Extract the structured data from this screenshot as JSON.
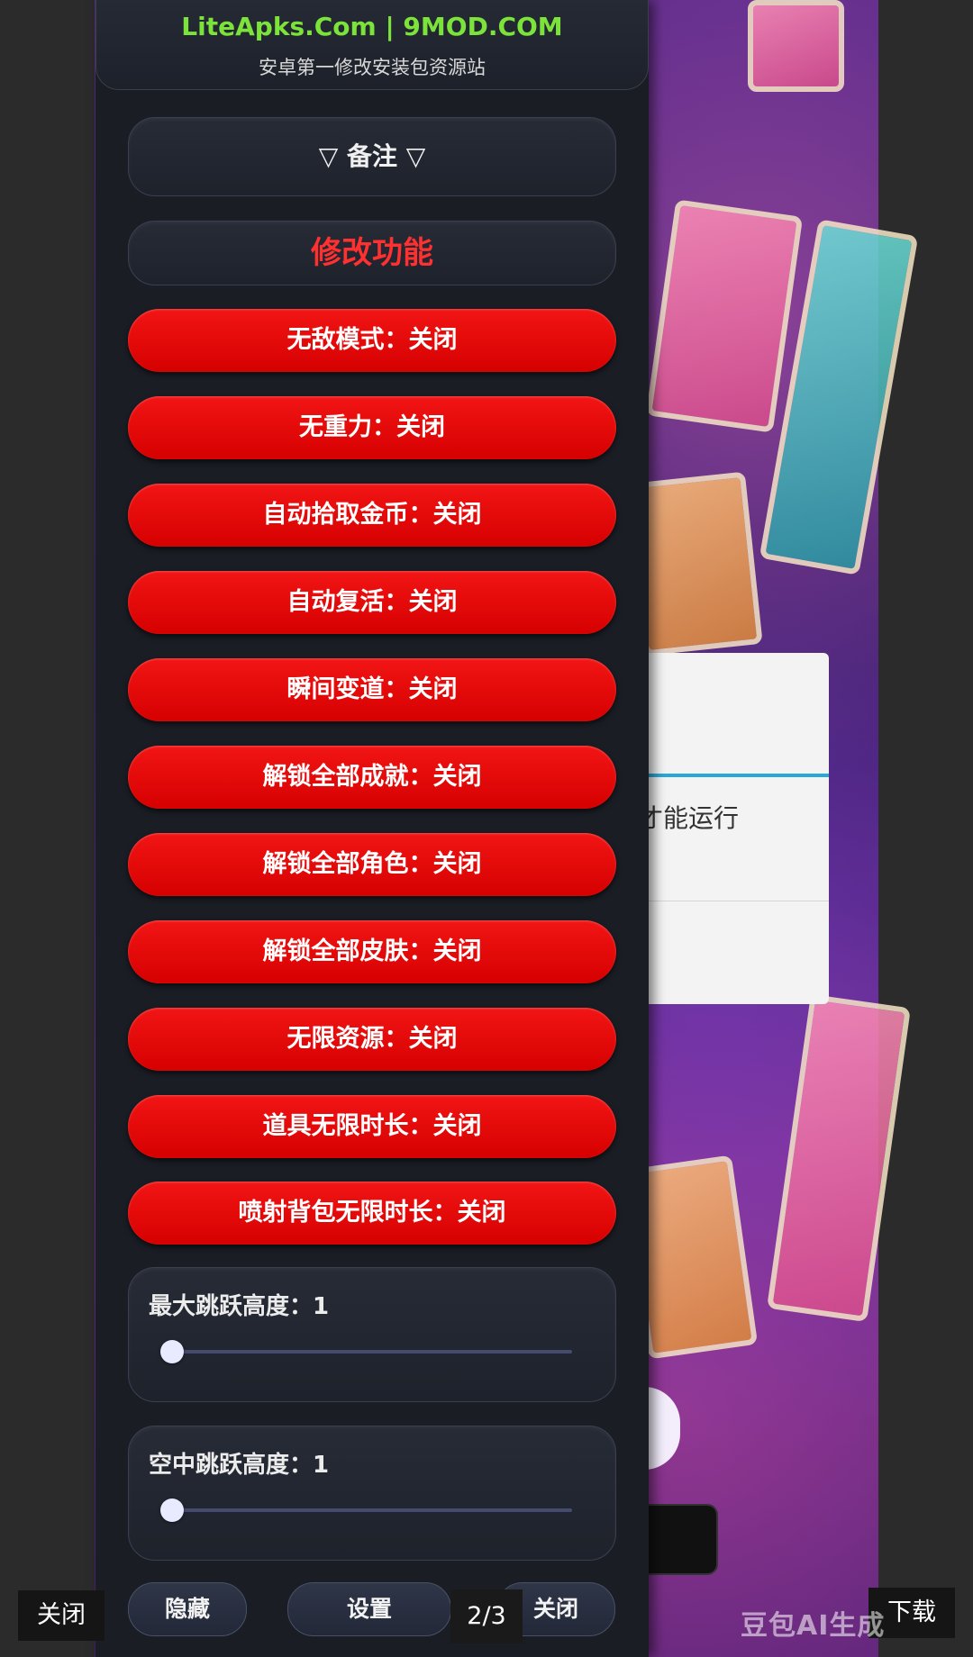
{
  "header": {
    "site": "LiteApks.Com | 9MOD.COM",
    "subtitle": "安卓第一修改安装包资源站"
  },
  "menu": {
    "notes_label": "▽ 备注 ▽",
    "section_title": "修改功能",
    "toggles": [
      "无敌模式：关闭",
      "无重力：关闭",
      "自动拾取金币：关闭",
      "自动复活：关闭",
      "瞬间变道：关闭",
      "解锁全部成就：关闭",
      "解锁全部角色：关闭",
      "解锁全部皮肤：关闭",
      "无限资源：关闭",
      "道具无限时长：关闭",
      "喷射背包无限时长：关闭"
    ],
    "sliders": [
      {
        "label": "最大跳跃高度：1",
        "value": 0
      },
      {
        "label": "空中跳跃高度：1",
        "value": 0
      }
    ],
    "bottom_buttons": {
      "hide": "隐藏",
      "settings": "设置",
      "close": "关闭"
    }
  },
  "background_dialog": {
    "text": "才能运行"
  },
  "viewer": {
    "close": "关闭",
    "page_indicator": "2/3",
    "download": "下载",
    "watermark": "豆包AI生成"
  },
  "colors": {
    "toggle_red": "#e80808",
    "section_title_red": "#ff3030",
    "site_green": "#7be33a",
    "panel_bg": "#1a1d24"
  }
}
